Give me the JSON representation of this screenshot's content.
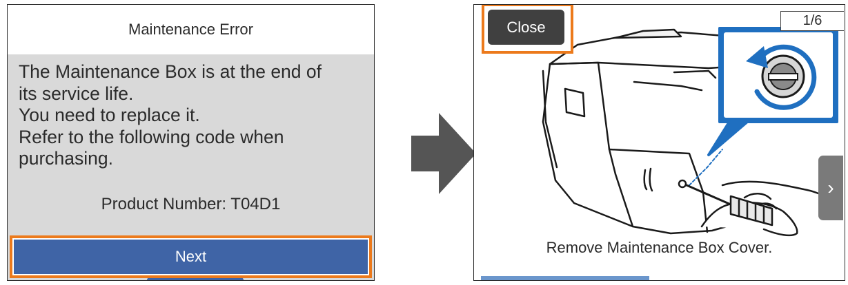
{
  "error_screen": {
    "title": "Maintenance Error",
    "message": "The Maintenance Box is at the end of\nits service life.\nYou need to replace it.\nRefer to the following code when\npurchasing.",
    "product_number": "Product Number: T04D1",
    "next_label": "Next"
  },
  "guide_screen": {
    "close_label": "Close",
    "page_indicator": "1/6",
    "next_icon": "chevron-right-icon",
    "caption": "Remove Maintenance Box Cover.",
    "progress": 0.167
  },
  "colors": {
    "highlight": "#ec7a1c",
    "button_blue": "#3f64a6",
    "callout_blue": "#1f6fc0",
    "panel_gray": "#d9d9d9",
    "arrow_gray": "#555555"
  }
}
